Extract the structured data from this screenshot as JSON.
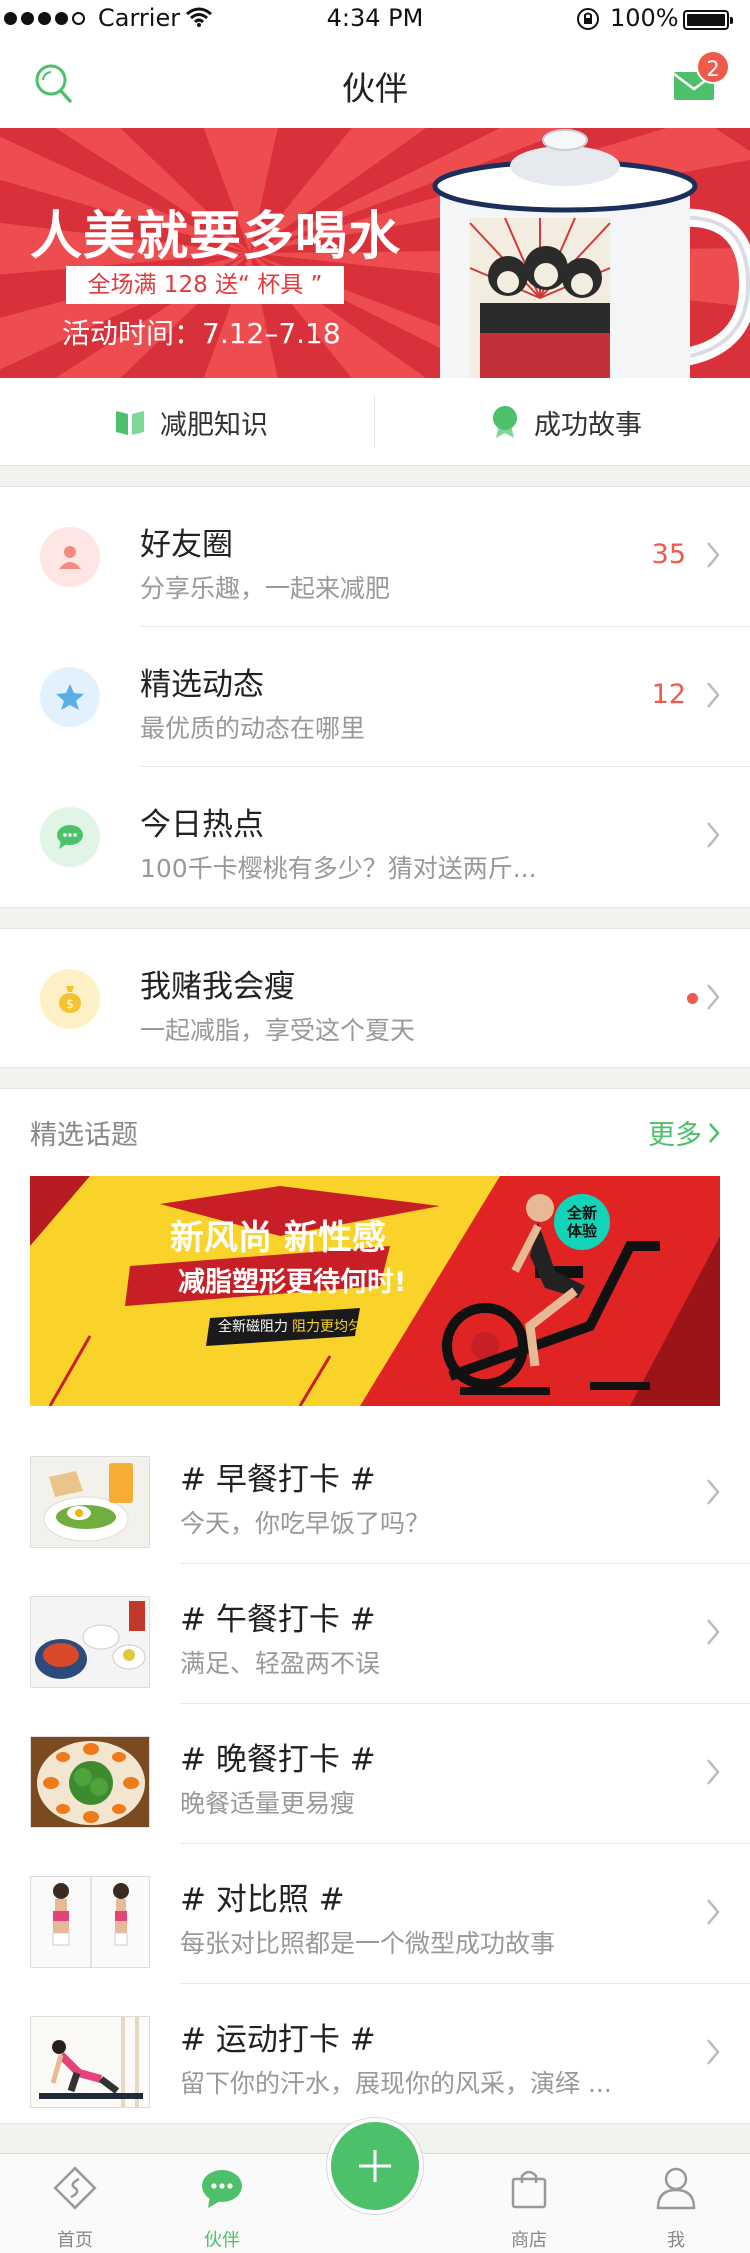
{
  "status_bar": {
    "carrier": "Carrier",
    "time": "4:34 PM",
    "battery": "100%"
  },
  "nav": {
    "title": "伙伴",
    "badge_count": "2",
    "left_icon": "search-icon",
    "right_icon": "mail-icon"
  },
  "banner": {
    "headline": "人美就要多喝水",
    "promo": "全场满 128 送“ 杯具 ”",
    "period": "活动时间：7.12–7.18"
  },
  "quick_tabs": [
    {
      "label": "减肥知识",
      "icon": "book-icon"
    },
    {
      "label": "成功故事",
      "icon": "award-icon"
    }
  ],
  "social": [
    {
      "title": "好友圈",
      "subtitle": "分享乐趣，一起来减肥",
      "count": "35",
      "icon": "user-icon",
      "color": "#f58a7e"
    },
    {
      "title": "精选动态",
      "subtitle": "最优质的动态在哪里",
      "count": "12",
      "icon": "star-icon",
      "color": "#5aaee8"
    },
    {
      "title": "今日热点",
      "subtitle": "100千卡樱桃有多少？猜对送两斤...",
      "icon": "chat-icon",
      "color": "#4cc16a"
    }
  ],
  "bet": {
    "title": "我赌我会瘦",
    "subtitle": "一起减脂，享受这个夏天",
    "icon": "money-bag-icon",
    "color": "#f4c430"
  },
  "topics": {
    "header": "精选话题",
    "more": "更多",
    "ad": {
      "headline1": "新风尚 新性感",
      "headline2": "减脂塑形更待何时!",
      "tagline_a": "全新磁阻力",
      "tagline_b": "阻力更均匀",
      "badge": "全新体验"
    },
    "items": [
      {
        "title": "# 早餐打卡 #",
        "subtitle": "今天，你吃早饭了吗？"
      },
      {
        "title": "# 午餐打卡 #",
        "subtitle": "满足、轻盈两不误"
      },
      {
        "title": "# 晚餐打卡 #",
        "subtitle": "晚餐适量更易瘦"
      },
      {
        "title": "# 对比照 #",
        "subtitle": "每张对比照都是一个微型成功故事"
      },
      {
        "title": "# 运动打卡 #",
        "subtitle": "留下你的汗水，展现你的风采，演绎 ..."
      }
    ]
  },
  "tabbar": [
    {
      "label": "首页",
      "icon": "home-icon"
    },
    {
      "label": "伙伴",
      "icon": "partner-chat-icon",
      "active": true
    },
    {
      "label": "",
      "icon": "plus-icon"
    },
    {
      "label": "商店",
      "icon": "shopping-bag-icon"
    },
    {
      "label": "我",
      "icon": "profile-icon"
    }
  ],
  "colors": {
    "accent": "#4cc16a",
    "alert": "#f05a4a",
    "banner_red": "#e23a3e",
    "ad_yellow": "#f9d32a"
  }
}
